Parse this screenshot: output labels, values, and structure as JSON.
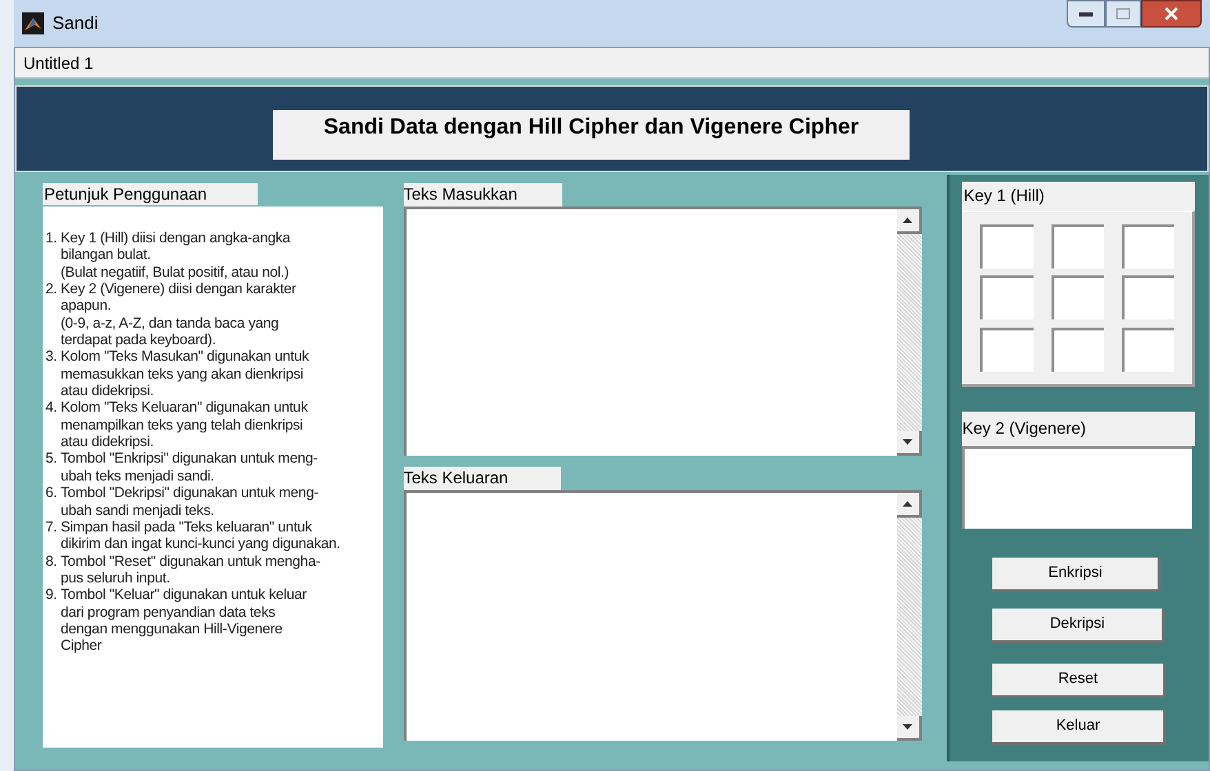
{
  "window": {
    "title": "Sandi"
  },
  "figure_tab": {
    "label": "Untitled 1"
  },
  "header": {
    "title": "Sandi Data dengan Hill Cipher dan Vigenere Cipher"
  },
  "instructions": {
    "label": "Petunjuk Penggunaan",
    "items": [
      {
        "number": "1.",
        "lines": [
          "Key 1 (Hill) diisi dengan angka-angka",
          "bilangan bulat.",
          "(Bulat negatiif, Bulat positif, atau nol.)"
        ]
      },
      {
        "number": "2.",
        "lines": [
          "Key 2 (Vigenere) diisi dengan karakter",
          "apapun.",
          "(0-9, a-z, A-Z, dan tanda baca yang",
          "terdapat pada keyboard)."
        ]
      },
      {
        "number": "3.",
        "lines": [
          "Kolom \"Teks Masukan\" digunakan untuk",
          "memasukkan teks yang akan dienkripsi",
          "atau didekripsi."
        ]
      },
      {
        "number": "4.",
        "lines": [
          "Kolom \"Teks Keluaran\" digunakan untuk",
          "menampilkan teks yang telah dienkripsi",
          "atau didekripsi."
        ]
      },
      {
        "number": "5.",
        "lines": [
          "Tombol \"Enkripsi\" digunakan untuk meng-",
          "ubah teks menjadi sandi."
        ]
      },
      {
        "number": "6.",
        "lines": [
          "Tombol \"Dekripsi\" digunakan untuk meng-",
          "ubah sandi menjadi teks."
        ]
      },
      {
        "number": "7.",
        "lines": [
          "Simpan hasil pada \"Teks keluaran\" untuk",
          "dikirim dan ingat kunci-kunci yang digunakan."
        ]
      },
      {
        "number": "8.",
        "lines": [
          "Tombol \"Reset\" digunakan untuk mengha-",
          "pus seluruh input."
        ]
      },
      {
        "number": "9.",
        "lines": [
          "Tombol \"Keluar\" digunakan untuk keluar",
          "dari program penyandian data teks",
          "dengan menggunakan Hill-Vigenere",
          "Cipher"
        ]
      }
    ]
  },
  "input_text": {
    "label": "Teks Masukkan"
  },
  "output_text": {
    "label": "Teks Keluaran"
  },
  "key1": {
    "label": "Key 1 (Hill)"
  },
  "key2": {
    "label": "Key 2 (Vigenere)"
  },
  "buttons": [
    "Enkripsi",
    "Dekripsi",
    "Reset",
    "Keluar"
  ]
}
